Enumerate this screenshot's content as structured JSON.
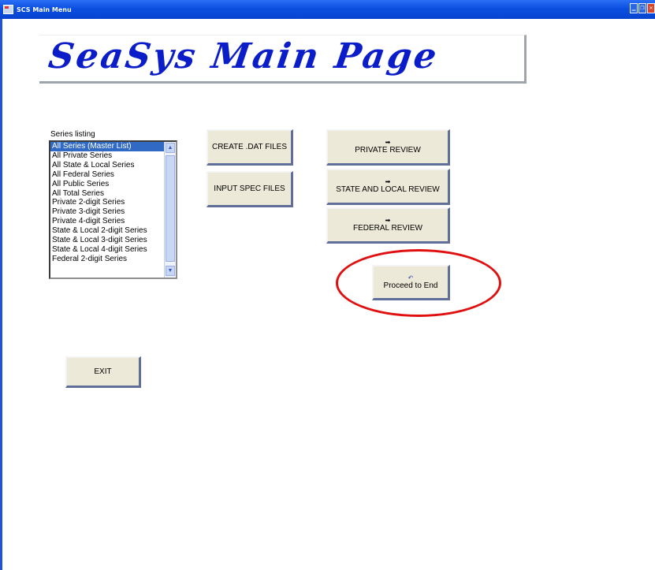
{
  "window": {
    "title": "SCS Main Menu"
  },
  "banner": {
    "title": "SeaSys Main Page"
  },
  "series": {
    "label": "Series listing",
    "items": [
      "All Series (Master List)",
      "All Private Series",
      "All State & Local Series",
      "All Federal Series",
      "All Public Series",
      "All Total Series",
      "Private 2-digit Series",
      "Private 3-digit Series",
      "Private 4-digit Series",
      "State & Local 2-digit Series",
      "State & Local 3-digit Series",
      "State & Local 4-digit Series",
      "Federal 2-digit Series"
    ],
    "selected": "All Series (Master List)"
  },
  "buttons": {
    "create_dat": "CREATE .DAT FILES",
    "input_spec": "INPUT SPEC FILES",
    "private_review": "PRIVATE REVIEW",
    "state_local_review": "STATE AND LOCAL REVIEW",
    "federal_review": "FEDERAL REVIEW",
    "proceed_end": "Proceed to End",
    "exit": "EXIT"
  },
  "colors": {
    "title_bar": "#0843d0",
    "banner_text": "#0b1dc9",
    "highlight_circle": "#e01010",
    "selection": "#316ac5"
  }
}
